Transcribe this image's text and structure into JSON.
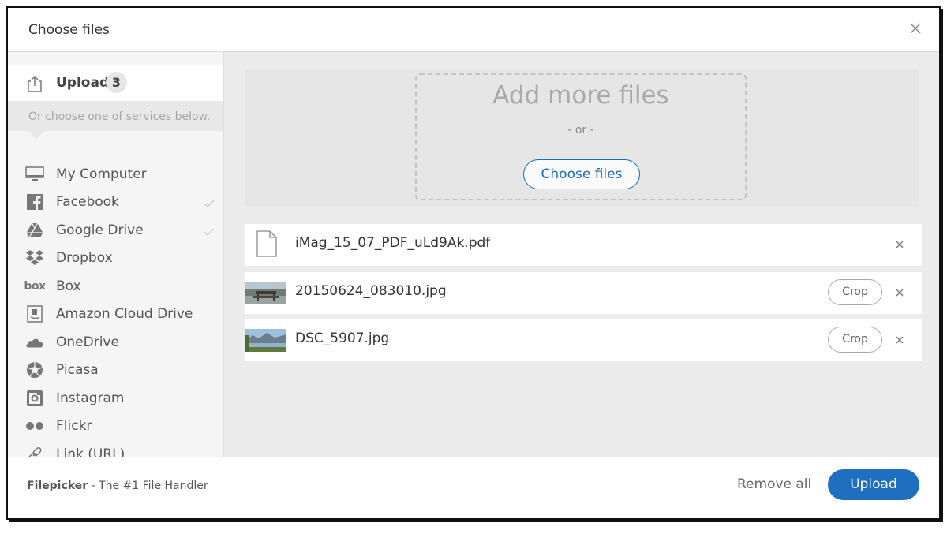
{
  "dialog": {
    "title": "Choose files",
    "close_icon": "close-icon"
  },
  "sidebar": {
    "upload": {
      "label": "Upload",
      "count": "3",
      "icon": "upload-icon"
    },
    "hint": "Or choose one of services below.",
    "services": [
      {
        "label": "My Computer",
        "icon": "computer-icon"
      },
      {
        "label": "Facebook",
        "icon": "facebook-icon",
        "connected": true
      },
      {
        "label": "Google Drive",
        "icon": "google-drive-icon",
        "connected": true
      },
      {
        "label": "Dropbox",
        "icon": "dropbox-icon"
      },
      {
        "label": "Box",
        "icon": "box-icon",
        "icon_text": "box"
      },
      {
        "label": "Amazon Cloud Drive",
        "icon": "amazon-icon"
      },
      {
        "label": "OneDrive",
        "icon": "onedrive-icon"
      },
      {
        "label": "Picasa",
        "icon": "picasa-icon"
      },
      {
        "label": "Instagram",
        "icon": "instagram-icon"
      },
      {
        "label": "Flickr",
        "icon": "flickr-icon"
      },
      {
        "label": "Link (URL)",
        "icon": "link-icon"
      }
    ]
  },
  "dropzone": {
    "title": "Add more files",
    "or_text": "- or -",
    "button_label": "Choose files"
  },
  "files": [
    {
      "name": "iMag_15_07_PDF_uLd9Ak.pdf",
      "type": "pdf",
      "icon": "document-icon"
    },
    {
      "name": "20150624_083010.jpg",
      "type": "image",
      "crop_label": "Crop"
    },
    {
      "name": "DSC_5907.jpg",
      "type": "image",
      "crop_label": "Crop"
    }
  ],
  "footer": {
    "brand_name": "Filepicker",
    "brand_tagline": " - The #1 File Handler",
    "remove_all_label": "Remove all",
    "upload_label": "Upload"
  },
  "colors": {
    "accent": "#1e6fc0",
    "sidebar_bg": "#f5f5f5",
    "main_bg": "#ececec"
  }
}
